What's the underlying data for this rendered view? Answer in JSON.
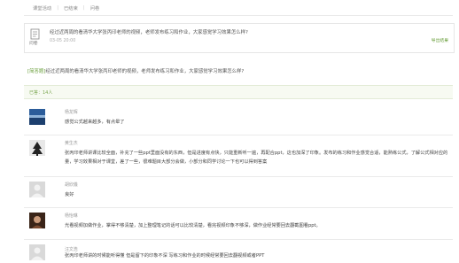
{
  "breadcrumb": {
    "items": [
      "课堂活动",
      "已结束",
      "问卷"
    ],
    "separator": "|"
  },
  "question": {
    "label": "问卷",
    "title": "经过近两周的看清华大学张丙印老师的视频，老师发布练习和作业，大家感觉学习效果怎么样?",
    "date": "03-05 20:00",
    "export_link": "导出结果"
  },
  "answer_intro": {
    "tag": "[简答题]",
    "text": "经过近两周的看清华大学张丙印老师的视频，老师发布练习和作业，大家感觉学习效果怎么样?"
  },
  "count_label": "已答：14人",
  "colors": {
    "accent": "#6a9f3c",
    "muted_text": "#999999",
    "border": "#e6e6e6",
    "count_bg": "#f7faf2"
  },
  "replies": [
    {
      "name": "杨龙辉",
      "text": "感觉公式越来越多，有点晕了",
      "avatar": "blue-landscape-avatar"
    },
    {
      "name": "黄生杰",
      "text": "张丙印老师讲课比较全面，补充了一些ppt里面没有的东西，但是进度有点快，只能重新听一遍，再配合ppt，这也加深了印象。发布的练习和作业感觉合适，能熟练公式，了解公式相对应的量，学习效果相对于课堂，差了一些，很难题目大部分会做，小部分和同学讨论一下也可以得到答案",
      "avatar": "black-white-tree-avatar"
    },
    {
      "name": "胡欣儀",
      "text": "良好",
      "avatar": "default-person-avatar"
    },
    {
      "name": "杨怡琳",
      "text": "光看视频加做作业，掌得不够清楚，加上整理笔记的话可以比较清楚，看完视频印象不够深，做作业经常要回去翻截图看ppt。",
      "avatar": "dark-portrait-avatar"
    },
    {
      "name": "汪文浩",
      "text": "张丙印老师讲的时候能听得懂 但是留下的印象不深 写练习和作业的时候经常要回去翻视频或者PPT",
      "avatar": "default-person-avatar"
    }
  ]
}
